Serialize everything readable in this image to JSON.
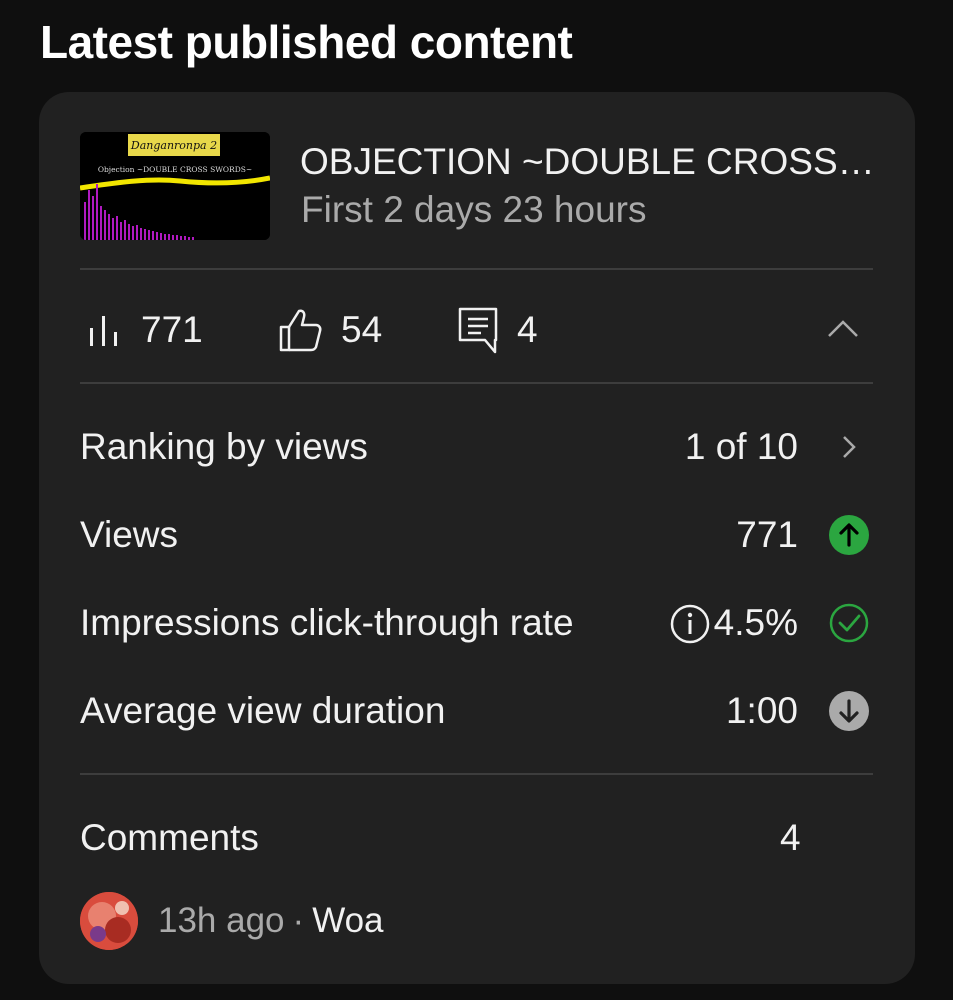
{
  "section": {
    "title": "Latest published content"
  },
  "video": {
    "title": "OBJECTION ~DOUBLE CROSS SWORDS~",
    "period": "First 2 days 23 hours",
    "thumbnail": {
      "logo_text": "Danganronpa 2",
      "caption": "Objection ~DOUBLE CROSS SWORDS~"
    }
  },
  "stats": {
    "views": "771",
    "likes": "54",
    "comments": "4"
  },
  "metrics": [
    {
      "label": "Ranking by views",
      "value": "1 of 10",
      "icon": "chevron-right-icon"
    },
    {
      "label": "Views",
      "value": "771",
      "icon": "arrow-up-circle-icon"
    },
    {
      "label": "Impressions click-through rate",
      "value": "4.5%",
      "icon": "check-circle-icon"
    },
    {
      "label": "Average view duration",
      "value": "1:00",
      "icon": "arrow-down-circle-icon"
    }
  ],
  "comments": {
    "label": "Comments",
    "count": "4",
    "latest": {
      "time": "13h ago",
      "separator": "·",
      "text": "Woa"
    }
  },
  "colors": {
    "background": "#0f0f0f",
    "card": "#212121",
    "up_green": "#2ba640",
    "neutral_gray": "#aaaaaa"
  }
}
